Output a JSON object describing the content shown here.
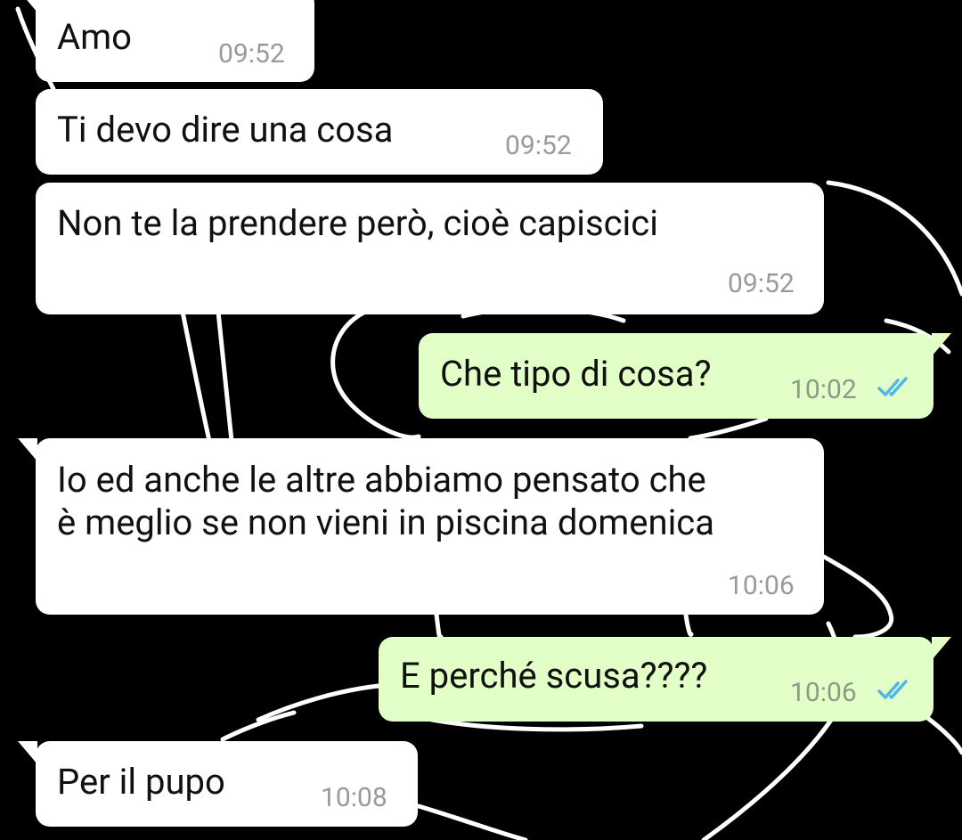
{
  "conversation": {
    "messages": [
      {
        "direction": "incoming",
        "text": "Amo",
        "time": "09:52"
      },
      {
        "direction": "incoming",
        "text": "Ti devo dire una cosa",
        "time": "09:52"
      },
      {
        "direction": "incoming",
        "text": "Non te la prendere però, cioè capiscici",
        "time": "09:52"
      },
      {
        "direction": "outgoing",
        "text": "Che tipo di cosa?",
        "time": "10:02",
        "status": "read",
        "status_icon": "double-check-icon"
      },
      {
        "direction": "incoming",
        "text": "Io ed anche le altre abbiamo pensato che\nè meglio se non vieni in piscina domenica",
        "time": "10:06"
      },
      {
        "direction": "outgoing",
        "text": "E perché scusa????",
        "time": "10:06",
        "status": "read",
        "status_icon": "double-check-icon"
      },
      {
        "direction": "incoming",
        "text": "Per il pupo",
        "time": "10:08"
      }
    ]
  },
  "colors": {
    "wallpaper_background": "#000000",
    "wallpaper_doodle": "#ffffff",
    "incoming_bubble": "#ffffff",
    "outgoing_bubble": "#e2ffc7",
    "read_ticks": "#4fb6ec"
  }
}
